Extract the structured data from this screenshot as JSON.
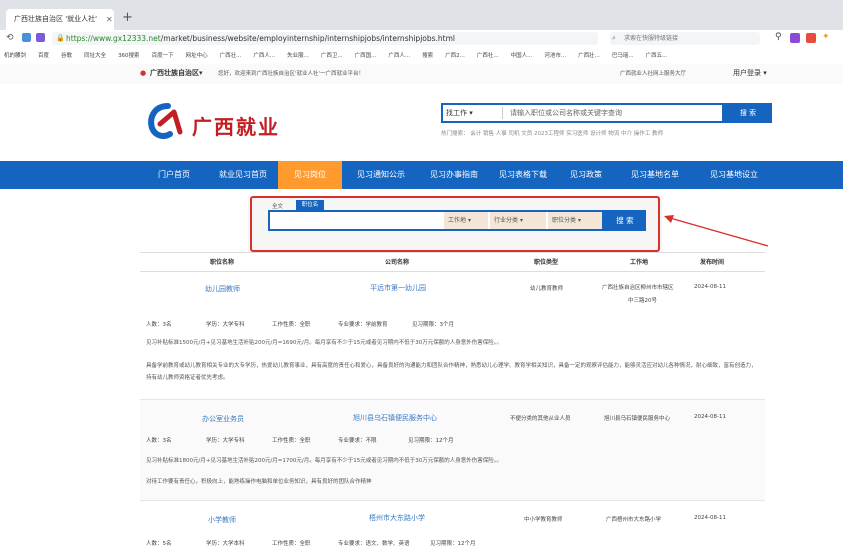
{
  "browser": {
    "tab_title": "广西壮族自治区 '就业人社'",
    "new_tab": "+",
    "url_host": "https://www.gx12333.net",
    "url_path": "/market/business/website/employinternship/internshipjobs/internshipjobs.html",
    "search_placeholder": "求索在快服特级链接",
    "bookmarks": [
      "机的腰剑",
      "百度",
      "谷歌",
      "同址大全",
      "360搜索",
      "百度一下",
      "网址中心",
      "广西壮...",
      "广西人...",
      "失业服...",
      "广西卫...",
      "广西国...",
      "广西人...",
      "搜索",
      "广西2...",
      "广西社...",
      "中国人...",
      "河池市...",
      "广西壮...",
      "巴马瑶...",
      "广西五..."
    ]
  },
  "site": {
    "location": "广西壮族自治区",
    "location_chevron": "▾",
    "welcome": "您好，欢迎来到广西壮族自治区'就业人社'一广西就业平台！",
    "top_link": "广西就业人社网上服务大厅",
    "user_login": "用户登录",
    "logo_text": "广西就业",
    "search_type": "找工作",
    "search_placeholder": "请输入职位或公司名称或关键字查询",
    "search_button": "搜 索",
    "hot_search": "热门搜索： 会计  销售  人事  司机  文员  2023工程师  实习医师  设计师  物流  中介  操作工  教师",
    "nav": [
      "门户首页",
      "就业见习首页",
      "见习岗位",
      "见习通知公示",
      "见习办事指南",
      "见习表格下载",
      "见习政策",
      "见习基地名单",
      "见习基地设立"
    ],
    "active_nav_index": 2
  },
  "filter": {
    "tab_all": "全文",
    "tab_job": "职位名",
    "dropdown_work": "工作地",
    "dropdown_industry": "行业分类",
    "dropdown_position": "职位分类",
    "search_button": "搜 索",
    "chevron": "▾"
  },
  "table": {
    "headers": [
      "职位名称",
      "公司名称",
      "职位类型",
      "工作地",
      "发布时间"
    ],
    "rows": [
      {
        "job": "幼儿园教师",
        "company": "平远市第一幼儿园",
        "type": "幼儿教育教师",
        "place": "广西壮族自治区柳州市市辖区",
        "place2": "中三路20号",
        "date": "2024-08-11",
        "meta": [
          "人数：3名",
          "学历：大学专科",
          "工作性质：全职",
          "专业要求：学前教育",
          "见习期限：3个月"
        ],
        "desc": [
          "见习补贴标准1500元/月+见习基地生活补贴200元/月=1690元/月。每月享有不少于15元或者见习期内不低于30万元保额的人身意外伤害保险。。",
          "具备学前教育或幼儿教育相关专业的大专学历，热爱幼儿教育事业，具有高度的责任心和爱心，具备良好的沟通能力和团队合作精神，熟悉幼儿心理学、教育学相关知识，具备一定的观察评估能力，能够灵活应对幼儿各种情况，耐心细致，富有创造力，持有幼儿教师资格证者优先考虑。"
        ]
      },
      {
        "job": "办公室业务员",
        "company": "旭川县乌石镇便民服务中心",
        "type": "不便分类的其他从业人员",
        "place": "旭川县乌石镇便民服务中心",
        "date": "2024-08-11",
        "meta": [
          "人数：3名",
          "学历：大学专科",
          "工作性质：全职",
          "专业要求：不限",
          "见习期限：12个月"
        ],
        "desc": [
          "见习补贴标准1800元/月+见习基地生活补贴200元/月=1700元/月。每月享有不少于15元或者见习期内不低于30万元保额的人身意外伤害保险。。",
          "对待工作要有责任心，积极向上，能熟练操作电脑和单位业务知识，具有良好的团队合作精神"
        ]
      },
      {
        "job": "小学教师",
        "company": "梧州市大东路小学",
        "type": "中小学教育教师",
        "place": "广西梧州市大东路小学",
        "date": "2024-08-11",
        "meta": [
          "人数：5名",
          "学历：大学本科",
          "工作性质：全职",
          "专业要求：语文、数学、英语",
          "见习期限：12个月"
        ]
      }
    ]
  },
  "colors": {
    "brand_blue": "#1565c0",
    "accent_orange": "#ff9b2e",
    "logo_red": "#c21f24",
    "annotation_red": "#d9302c"
  }
}
